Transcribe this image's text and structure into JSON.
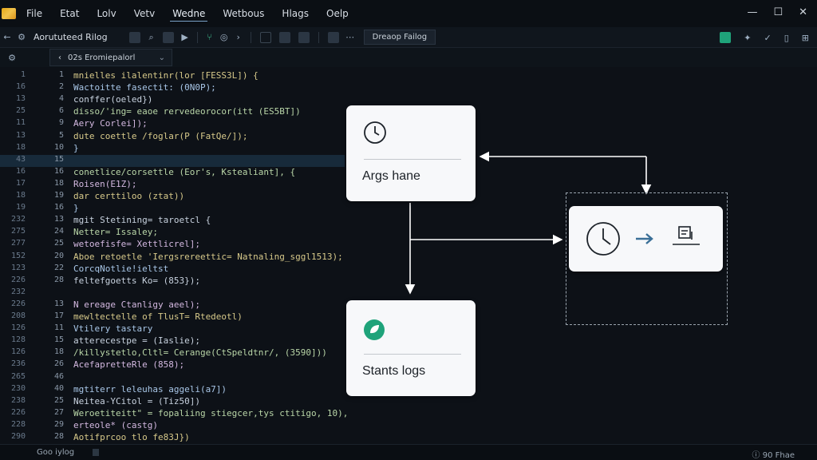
{
  "menu": {
    "items": [
      "File",
      "Etat",
      "Lolv",
      "Vetv",
      "Wedne",
      "Wetbous",
      "Hlags",
      "Oelp"
    ],
    "active_index": 4
  },
  "window_controls": {
    "minimize": "—",
    "maximize": "☐",
    "close": "✕"
  },
  "toolbar": {
    "project_title": "Aorututeed Rilog",
    "tab_chip": "Dreaop Failog"
  },
  "editor_tab": {
    "title": "02s Eromiepalorl"
  },
  "code": {
    "highlight_line": 7,
    "lines": [
      {
        "a": "1",
        "b": "1",
        "text": "mnielles ilalentinr(lor [FESS3L]) {"
      },
      {
        "a": "16",
        "b": "2",
        "text": "  Wactoitte fasectit: (0N0P);"
      },
      {
        "a": "13",
        "b": "4",
        "text": "conffer(oeled})"
      },
      {
        "a": "25",
        "b": "6",
        "text": "  disso/'ing= eaoe rervedeorocor(itt (ES5BT])"
      },
      {
        "a": "11",
        "b": "9",
        "text": "  Aery Corlei]);"
      },
      {
        "a": "13",
        "b": "5",
        "text": "  dute coettle /foglar(P (FatQe/]);"
      },
      {
        "a": "18",
        "b": "10",
        "text": "}"
      },
      {
        "a": "43",
        "b": "15",
        "text": ""
      },
      {
        "a": "16",
        "b": "16",
        "text": "conetlice/corsettle (Eor's, Kstealiant], {"
      },
      {
        "a": "17",
        "b": "18",
        "text": "  Roisen(E1Z);"
      },
      {
        "a": "18",
        "b": "19",
        "text": "  dar certtiloo (ztat))"
      },
      {
        "a": "19",
        "b": "16",
        "text": "}"
      },
      {
        "a": "232",
        "b": "13",
        "text": "mgit Stetining= taroetcl {"
      },
      {
        "a": "275",
        "b": "24",
        "text": "  Netter= Issaley;"
      },
      {
        "a": "277",
        "b": "25",
        "text": "  wetoefisfe= Xettlicrel];"
      },
      {
        "a": "152",
        "b": "20",
        "text": "  Aboe retoetle 'Iergsrereettic= Natnaling_sggl1513);"
      },
      {
        "a": "123",
        "b": "22",
        "text": "CorcqNotlie!ieltst"
      },
      {
        "a": "226",
        "b": "28",
        "text": "feltefgoetts Ko= (853});"
      },
      {
        "a": "232",
        "b": "",
        "text": ""
      },
      {
        "a": "226",
        "b": "13",
        "text": "N ereage Ctanligy aeel);"
      },
      {
        "a": "208",
        "b": "17",
        "text": "mewltectelle of TlusT= Rtedeotl)"
      },
      {
        "a": "126",
        "b": "11",
        "text": "Vtilery tastary"
      },
      {
        "a": "128",
        "b": "15",
        "text": "atterecestpe = (Iaslie);"
      },
      {
        "a": "126",
        "b": "18",
        "text": "/killystetlo,Cltl= Cerange(CtSpeldtnr/, (3590]))"
      },
      {
        "a": "236",
        "b": "26",
        "text": "AcefapretteRle (858);"
      },
      {
        "a": "265",
        "b": "46",
        "text": ""
      },
      {
        "a": "230",
        "b": "40",
        "text": "mgtiterr leleuhas aggeli(a7])"
      },
      {
        "a": "238",
        "b": "25",
        "text": "  Neitea-YCitol = (Tiz50])"
      },
      {
        "a": "226",
        "b": "27",
        "text": "  Weroetiteitt\" = fopaliing stiegcer,tys ctitigo, 10),"
      },
      {
        "a": "228",
        "b": "29",
        "text": " erteole* (castg)"
      },
      {
        "a": "290",
        "b": "28",
        "text": "Aotifprcoo tlo fe83J})"
      }
    ]
  },
  "diagram": {
    "node_args": {
      "label": "Args hane",
      "icon": "clock-icon"
    },
    "node_logs": {
      "label": "Stants logs",
      "icon": "leaf-badge-icon"
    },
    "node_result": {
      "icons": [
        "clock-icon",
        "arrow-right-icon",
        "printer-icon"
      ]
    },
    "colors": {
      "node_bg": "#f7f8fa",
      "connector": "#ffffff",
      "badge_green": "#1fa37a"
    }
  },
  "status": {
    "left": "Goo iylog",
    "right": "ⓘ 90 Fhae"
  }
}
